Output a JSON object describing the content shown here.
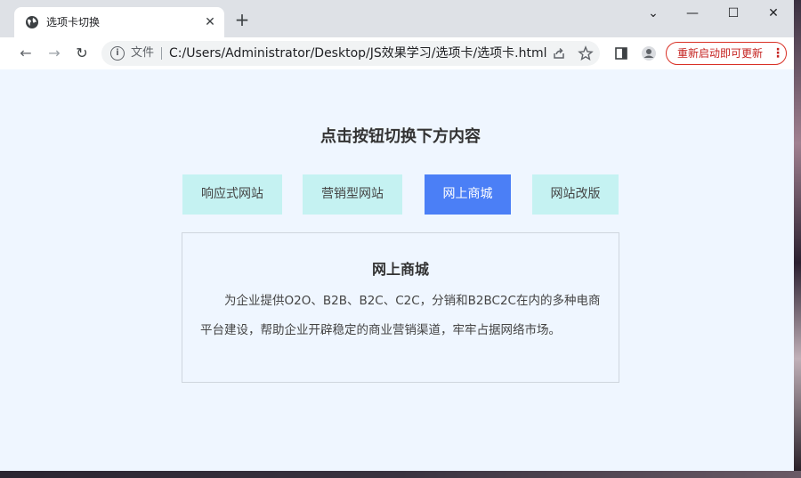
{
  "browser": {
    "tab": {
      "title": "选项卡切换",
      "close_glyph": "✕"
    },
    "new_tab_glyph": "+",
    "window_controls": {
      "dropdown": "⌄",
      "minimize": "—",
      "maximize": "☐",
      "close": "✕"
    },
    "toolbar": {
      "back_glyph": "←",
      "forward_glyph": "→",
      "reload_glyph": "↻",
      "scheme_label": "文件",
      "url": "C:/Users/Administrator/Desktop/JS效果学习/选项卡/选项卡.html",
      "update_label": "重新启动即可更新",
      "update_menu_glyph": "⋮"
    }
  },
  "page": {
    "heading": "点击按钮切换下方内容",
    "tabs": [
      {
        "label": "响应式网站",
        "active": false
      },
      {
        "label": "营销型网站",
        "active": false
      },
      {
        "label": "网上商城",
        "active": true
      },
      {
        "label": "网站改版",
        "active": false
      }
    ],
    "panel": {
      "title": "网上商城",
      "text": "为企业提供O2O、B2B、B2C、C2C，分销和B2BC2C在内的多种电商平台建设，帮助企业开辟稳定的商业营销渠道，牢牢占据网络市场。"
    }
  },
  "colors": {
    "tab_inactive": "#c5f2f2",
    "tab_active": "#4b7ff6",
    "page_background": "#eff6ff",
    "update_accent": "#d93025"
  }
}
